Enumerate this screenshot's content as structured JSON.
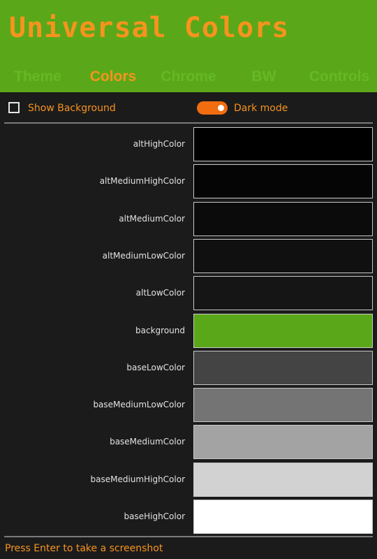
{
  "app": {
    "title": "Universal Colors"
  },
  "tabs": [
    {
      "label": "Theme",
      "active": false
    },
    {
      "label": "Colors",
      "active": true
    },
    {
      "label": "Chrome",
      "active": false
    },
    {
      "label": "BW",
      "active": false
    },
    {
      "label": "Controls",
      "active": false
    }
  ],
  "toolbar": {
    "show_background_label": "Show Background",
    "show_background_checked": false,
    "dark_mode_label": "Dark mode",
    "dark_mode_on": true
  },
  "colors": [
    {
      "name": "altHighColor",
      "hex": "#000000"
    },
    {
      "name": "altMediumHighColor",
      "hex": "#050505"
    },
    {
      "name": "altMediumColor",
      "hex": "#0b0b0b"
    },
    {
      "name": "altMediumLowColor",
      "hex": "#101010"
    },
    {
      "name": "altLowColor",
      "hex": "#151515"
    },
    {
      "name": "background",
      "hex": "#5aa819"
    },
    {
      "name": "baseLowColor",
      "hex": "#444444"
    },
    {
      "name": "baseMediumLowColor",
      "hex": "#747474"
    },
    {
      "name": "baseMediumColor",
      "hex": "#a3a3a3"
    },
    {
      "name": "baseMediumHighColor",
      "hex": "#d2d2d2"
    },
    {
      "name": "baseHighColor",
      "hex": "#ffffff"
    }
  ],
  "status": {
    "text": "Press Enter to take a screenshot"
  },
  "theme": {
    "accent": "#f7931e",
    "header_bg": "#5aa819",
    "inactive_tab": "#66b826",
    "page_bg": "#1b1b1b",
    "toggle_on": "#f26c10"
  }
}
